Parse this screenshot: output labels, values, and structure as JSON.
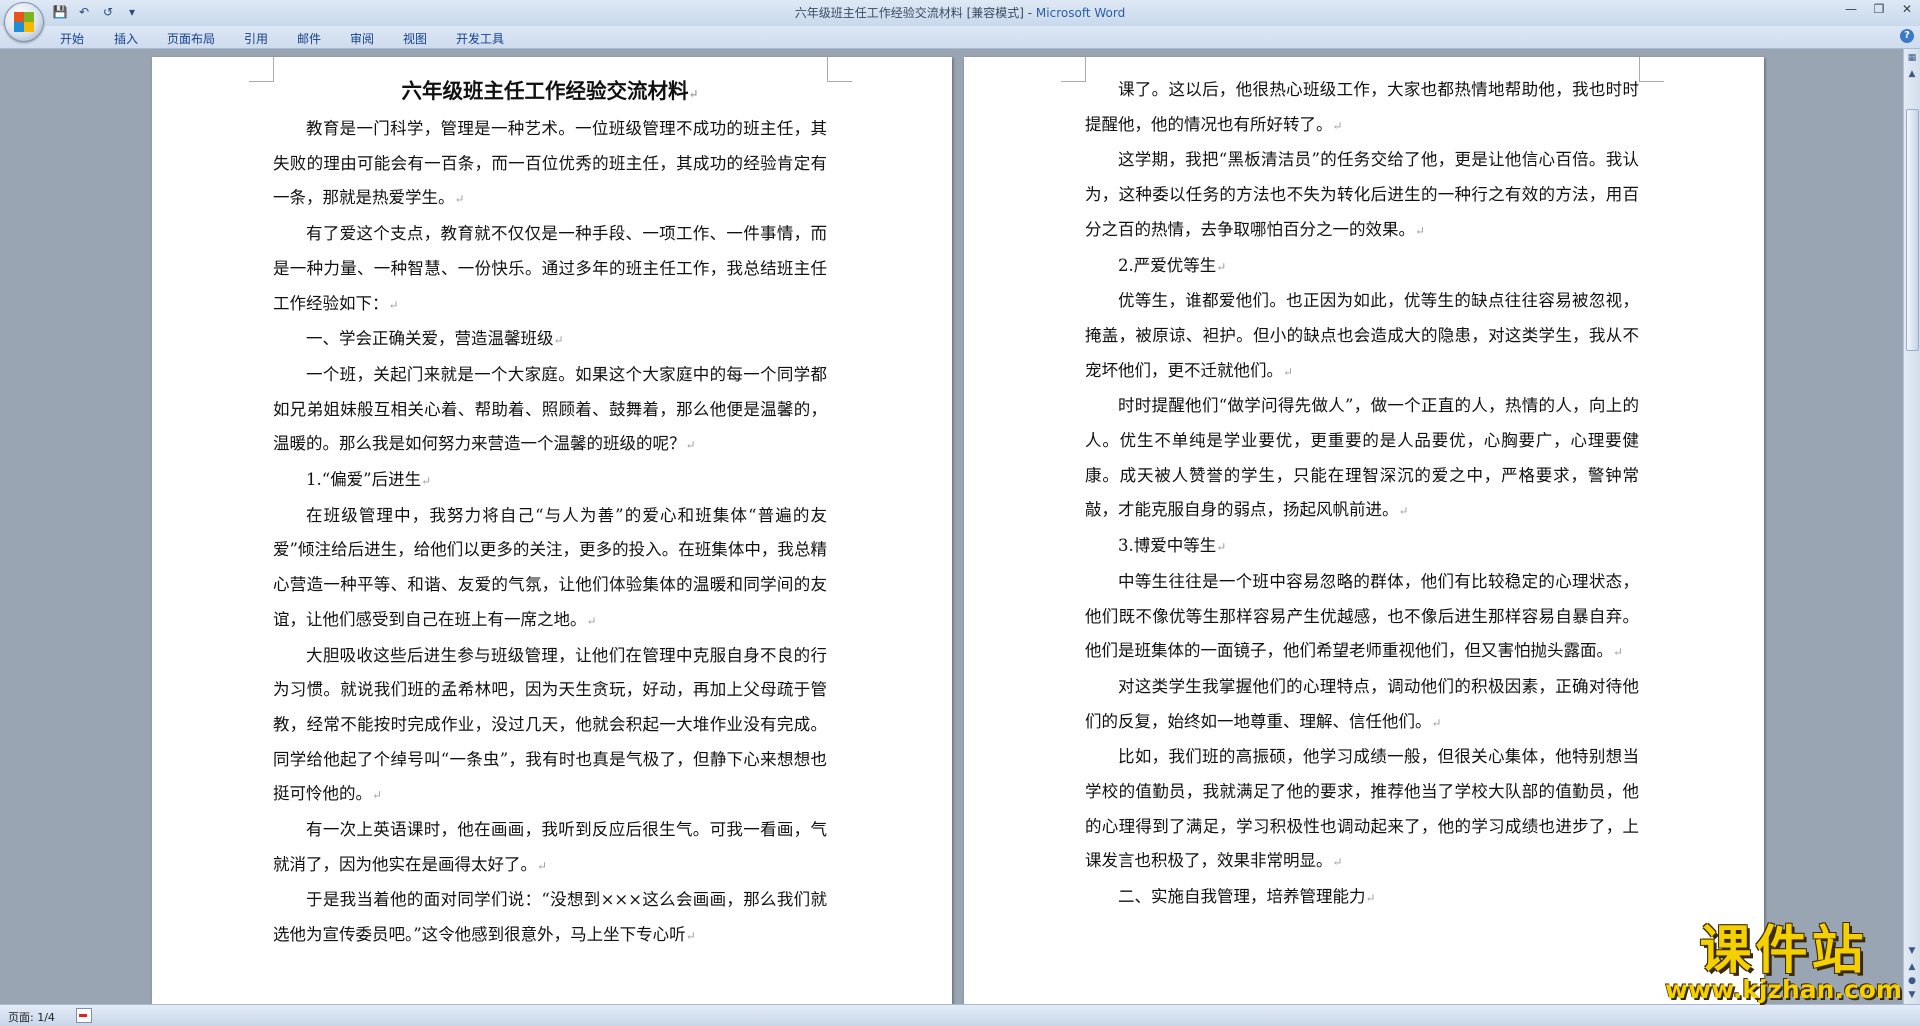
{
  "window": {
    "title_doc": "六年级班主任工作经验交流材料 [兼容模式] - ",
    "title_app": "Microsoft Word"
  },
  "ribbon_tabs": [
    "开始",
    "插入",
    "页面布局",
    "引用",
    "邮件",
    "审阅",
    "视图",
    "开发工具"
  ],
  "qat": [
    "save-icon",
    "undo-icon",
    "redo-icon",
    "customize-icon"
  ],
  "document": {
    "title": "六年级班主任工作经验交流材料",
    "left_paragraphs": [
      {
        "text": "教育是一门科学，管理是一种艺术。一位班级管理不成功的班主任，其失败的理由可能会有一百条，而一百位优秀的班主任，其成功的经验肯定有一条，那就是热爱学生。"
      },
      {
        "text": "有了爱这个支点，教育就不仅仅是一种手段、一项工作、一件事情，而是一种力量、一种智慧、一份快乐。通过多年的班主任工作，我总结班主任工作经验如下："
      },
      {
        "text": "一、学会正确关爱，营造温馨班级"
      },
      {
        "text": "一个班，关起门来就是一个大家庭。如果这个大家庭中的每一个同学都如兄弟姐妹般互相关心着、帮助着、照顾着、鼓舞着，那么他便是温馨的，温暖的。那么我是如何努力来营造一个温馨的班级的呢？"
      },
      {
        "text": "1.“偏爱”后进生"
      },
      {
        "text": "在班级管理中，我努力将自己“与人为善”的爱心和班集体“普遍的友爱”倾注给后进生，给他们以更多的关注，更多的投入。在班集体中，我总精心营造一种平等、和谐、友爱的气氛，让他们体验集体的温暖和同学间的友谊，让他们感受到自己在班上有一席之地。"
      },
      {
        "text": "大胆吸收这些后进生参与班级管理，让他们在管理中克服自身不良的行为习惯。就说我们班的孟希林吧，因为天生贪玩，好动，再加上父母疏于管教，经常不能按时完成作业，没过几天，他就会积起一大堆作业没有完成。同学给他起了个绰号叫“一条虫”，我有时也真是气极了，但静下心来想想也挺可怜他的。"
      },
      {
        "text": "有一次上英语课时，他在画画，我听到反应后很生气。可我一看画，气就消了，因为他实在是画得太好了。"
      },
      {
        "text": "于是我当着他的面对同学们说：“没想到×××这么会画画，那么我们就选他为宣传委员吧。”这令他感到很意外，马上坐下专心听"
      }
    ],
    "right_paragraphs": [
      {
        "text": "课了。这以后，他很热心班级工作，大家也都热情地帮助他，我也时时提醒他，他的情况也有所好转了。"
      },
      {
        "text": "这学期，我把“黑板清洁员”的任务交给了他，更是让他信心百倍。我认为，这种委以任务的方法也不失为转化后进生的一种行之有效的方法，用百分之百的热情，去争取哪怕百分之一的效果。"
      },
      {
        "text": "2.严爱优等生"
      },
      {
        "text": "优等生，谁都爱他们。也正因为如此，优等生的缺点往往容易被忽视，掩盖，被原谅、袒护。但小的缺点也会造成大的隐患，对这类学生，我从不宠坏他们，更不迁就他们。"
      },
      {
        "text": "时时提醒他们“做学问得先做人”，做一个正直的人，热情的人，向上的人。优生不单纯是学业要优，更重要的是人品要优，心胸要广，心理要健康。成天被人赞誉的学生，只能在理智深沉的爱之中，严格要求，警钟常敲，才能克服自身的弱点，扬起风帆前进。"
      },
      {
        "text": "3.博爱中等生"
      },
      {
        "text": "中等生往往是一个班中容易忽略的群体，他们有比较稳定的心理状态，他们既不像优等生那样容易产生优越感，也不像后进生那样容易自暴自弃。他们是班集体的一面镜子，他们希望老师重视他们，但又害怕抛头露面。"
      },
      {
        "text": "对这类学生我掌握他们的心理特点，调动他们的积极因素，正确对待他们的反复，始终如一地尊重、理解、信任他们。"
      },
      {
        "text": "比如，我们班的高振硕，他学习成绩一般，但很关心集体，他特别想当学校的值勤员，我就满足了他的要求，推荐他当了学校大队部的值勤员，他的心理得到了满足，学习积极性也调动起来了，他的学习成绩也进步了，上课发言也积极了，效果非常明显。"
      },
      {
        "text": "二、实施自我管理，培养管理能力"
      }
    ]
  },
  "statusbar": {
    "page": "页面: 1/4"
  },
  "watermark": {
    "title": "课件站",
    "url": "www.kjzhan.com"
  },
  "colors": {
    "accent": "#15428b",
    "workspace": "#9aa5b4",
    "watermark": "#f4d000"
  }
}
